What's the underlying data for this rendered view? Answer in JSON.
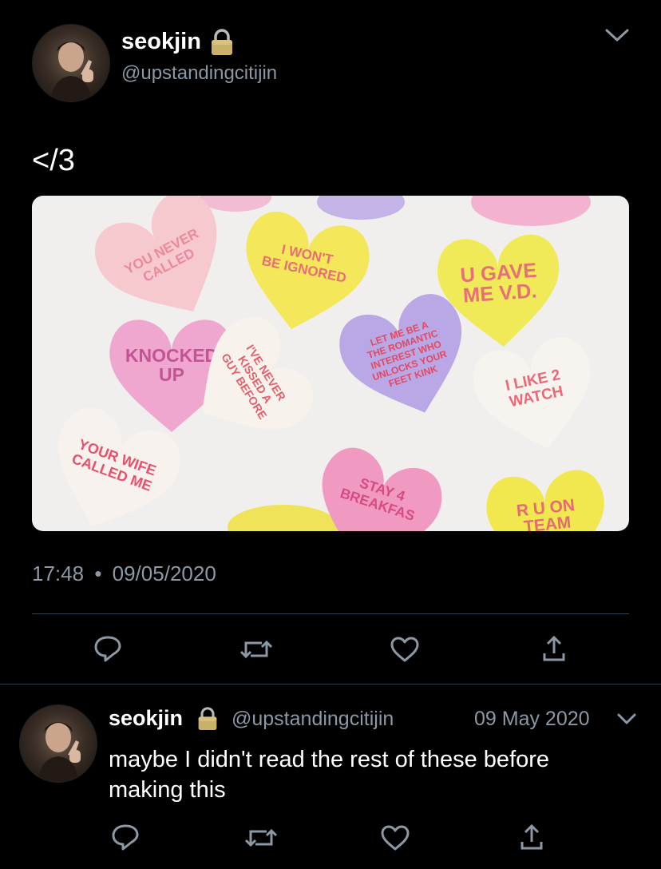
{
  "tweet": {
    "display_name": "seokjin",
    "handle": "@upstandingcitijin",
    "text": "</3",
    "timestamp": "17:48",
    "date": "09/05/2020",
    "separator": "•",
    "image": {
      "hearts": [
        {
          "lines": [
            "YOU NEVER",
            "CALLED"
          ],
          "color": "#f6c9cf"
        },
        {
          "lines": [
            "I WON'T",
            "BE IGNORED"
          ],
          "color": "#f4e85a"
        },
        {
          "lines": [
            "U GAVE",
            "ME V.D."
          ],
          "color": "#f1ea58"
        },
        {
          "lines": [
            "KNOCKED",
            "UP"
          ],
          "color": "#f0a7cf"
        },
        {
          "lines": [
            "I'VE NEVER",
            "KISSED A",
            "GUY BEFORE"
          ],
          "color": "#f7f3ec"
        },
        {
          "lines": [
            "LET ME BE A",
            "THE ROMANTIC",
            "INTEREST WHO",
            "UNLOCKS YOUR",
            "FEET KINK"
          ],
          "color": "#b9a7e6"
        },
        {
          "lines": [
            "I LIKE 2",
            "WATCH"
          ],
          "color": "#f7f3ee"
        },
        {
          "lines": [
            "YOUR WIFE",
            "CALLED ME"
          ],
          "color": "#f7f2ee"
        },
        {
          "lines": [
            "STAY 4",
            "BREAKFAS"
          ],
          "color": "#f19ac1"
        },
        {
          "lines": [
            "R U ON",
            "TEAM"
          ],
          "color": "#f1e74f"
        }
      ]
    }
  },
  "reply": {
    "display_name": "seokjin",
    "handle": "@upstandingcitijin",
    "date": "09 May 2020",
    "text_line1": "maybe I didn't read the rest of these before",
    "text_line2": "making this"
  },
  "icons": {
    "reply": "reply-icon",
    "retweet": "retweet-icon",
    "like": "heart-icon",
    "share": "share-icon",
    "lock": "lock-icon",
    "chevron": "chevron-down-icon"
  },
  "colors": {
    "background": "#000000",
    "text": "#ffffff",
    "muted": "#8b98a5",
    "divider": "#38444d",
    "lock_body": "#c9b06b"
  }
}
